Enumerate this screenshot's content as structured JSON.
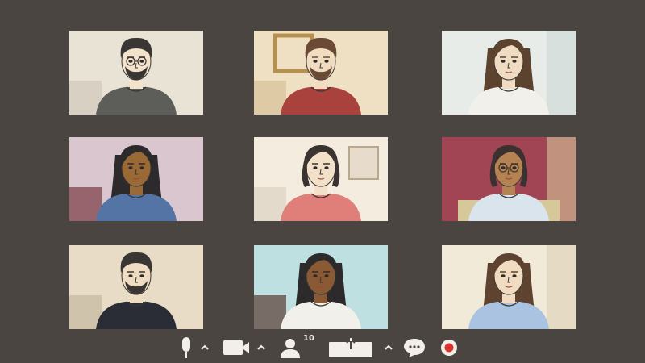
{
  "meeting": {
    "participants": [
      {
        "id": "p1",
        "bg": "#e9e3d6",
        "wall": "#cfc8bb",
        "shirt": "#5d5d5a",
        "skin": "#f3e3cc",
        "hair": "#3a3633",
        "style": "short-glasses-beard"
      },
      {
        "id": "p2",
        "bg": "#efe0c4",
        "wall": "#d7c29a",
        "shirt": "#a9413d",
        "skin": "#f1dcc1",
        "hair": "#6a4a34",
        "style": "short-beard"
      },
      {
        "id": "p3",
        "bg": "#e7ece8",
        "wall": "#cfd8d6",
        "shirt": "#f2f0ea",
        "skin": "#f0dcc3",
        "hair": "#5c4330",
        "style": "long"
      },
      {
        "id": "p4",
        "bg": "#d9c6cf",
        "wall": "#7a3b44",
        "shirt": "#5574a6",
        "skin": "#9a6a36",
        "hair": "#2d2a2b",
        "style": "long"
      },
      {
        "id": "p5",
        "bg": "#f3ecdf",
        "wall": "#ddd3c2",
        "shirt": "#e07f79",
        "skin": "#f3e0c8",
        "hair": "#3b3330",
        "style": "bob"
      },
      {
        "id": "p6",
        "bg": "#a14555",
        "wall": "#d7c89a",
        "shirt": "#d9e4ec",
        "skin": "#b58251",
        "hair": "#3a3130",
        "style": "bob-glasses"
      },
      {
        "id": "p7",
        "bg": "#e8dcc6",
        "wall": "#c4b89f",
        "shirt": "#2a2d36",
        "skin": "#f0dcc2",
        "hair": "#3a3633",
        "style": "short-beard"
      },
      {
        "id": "p8",
        "bg": "#bfe0e1",
        "wall": "#5a3c32",
        "shirt": "#f2f0ea",
        "skin": "#8a5a34",
        "hair": "#2d2a2b",
        "style": "long"
      },
      {
        "id": "p9",
        "bg": "#f1ead8",
        "wall": "#ddd1b8",
        "shirt": "#a9c3e0",
        "skin": "#f1dcc1",
        "hair": "#5e4330",
        "style": "long"
      }
    ]
  },
  "toolbar": {
    "participants_count": "10",
    "icons": {
      "mic": "microphone-icon",
      "camera": "video-camera-icon",
      "people": "participants-icon",
      "share": "share-screen-icon",
      "chat": "chat-icon",
      "record": "record-icon"
    },
    "accent": "#d9342b",
    "icon_color": "#f2eee9"
  }
}
